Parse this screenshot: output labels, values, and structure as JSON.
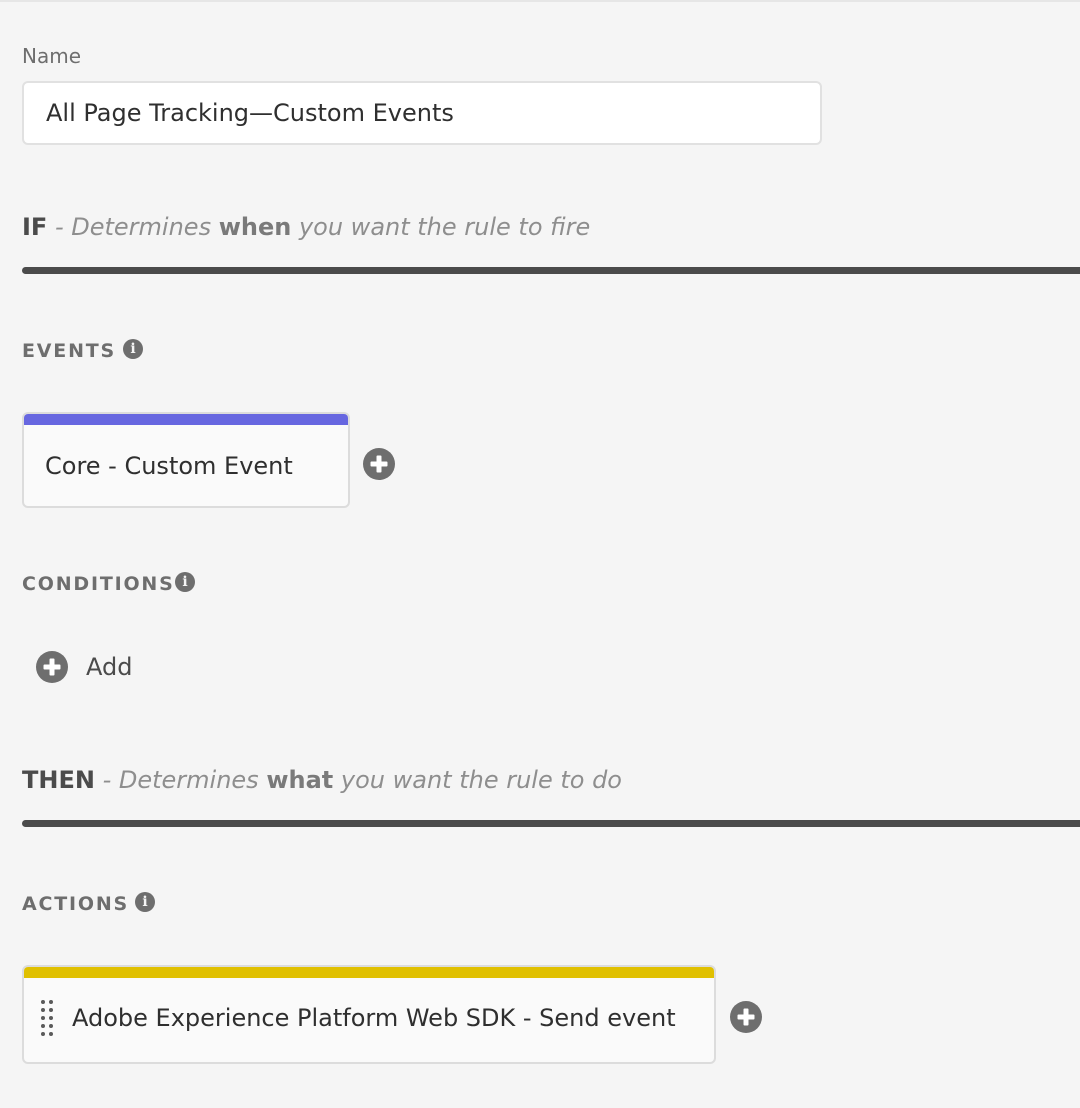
{
  "name_field": {
    "label": "Name",
    "value": "All Page Tracking—Custom Events"
  },
  "if_section": {
    "keyword": "IF",
    "separator": " - ",
    "desc_prefix": "Determines ",
    "desc_strong": "when",
    "desc_suffix": " you want the rule to fire"
  },
  "events": {
    "heading": "EVENTS",
    "cards": [
      {
        "label": "Core - Custom Event",
        "accent_color": "#6767e0"
      }
    ]
  },
  "conditions": {
    "heading": "CONDITIONS",
    "add_label": "Add"
  },
  "then_section": {
    "keyword": "THEN",
    "separator": " - ",
    "desc_prefix": "Determines ",
    "desc_strong": "what",
    "desc_suffix": " you want the rule to do"
  },
  "actions": {
    "heading": "ACTIONS",
    "cards": [
      {
        "label": "Adobe Experience Platform Web SDK - Send event",
        "accent_color": "#e0c000"
      }
    ]
  },
  "icons": {
    "info": "info-icon",
    "add": "plus-circle-icon",
    "drag": "drag-handle-icon"
  },
  "colors": {
    "background": "#f5f5f5",
    "divider": "#4b4b4b",
    "icon": "#6e6e6e"
  }
}
